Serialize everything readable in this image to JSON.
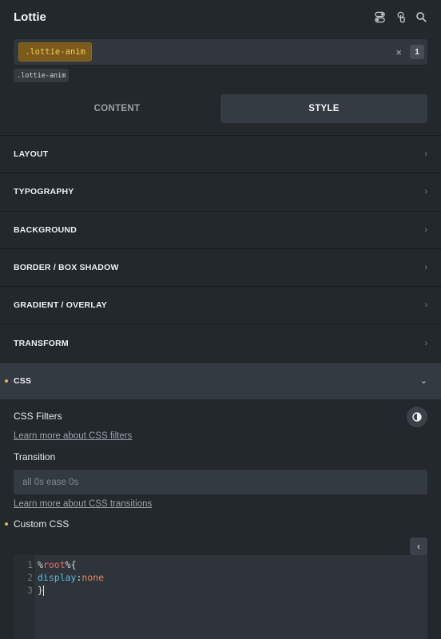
{
  "header": {
    "title": "Lottie",
    "icons": [
      "toggle-icon",
      "touch-icon",
      "search-icon"
    ]
  },
  "selector": {
    "active_class": ".lottie-anim",
    "clear_symbol": "×",
    "count": "1",
    "class_chip": ".lottie-anim"
  },
  "tabs": {
    "content": "CONTENT",
    "style": "STYLE",
    "active": "style"
  },
  "sections": [
    {
      "label": "LAYOUT",
      "open": false
    },
    {
      "label": "TYPOGRAPHY",
      "open": false
    },
    {
      "label": "BACKGROUND",
      "open": false
    },
    {
      "label": "BORDER / BOX SHADOW",
      "open": false
    },
    {
      "label": "GRADIENT / OVERLAY",
      "open": false
    },
    {
      "label": "TRANSFORM",
      "open": false
    },
    {
      "label": "CSS",
      "open": true
    }
  ],
  "css_panel": {
    "filters_label": "CSS Filters",
    "filters_link": "Learn more about CSS filters",
    "transition_label": "Transition",
    "transition_placeholder": "all 0s ease 0s",
    "transition_link": "Learn more about CSS transitions",
    "custom_css_label": "Custom CSS"
  },
  "editor": {
    "line_numbers": [
      "1",
      "2",
      "3"
    ],
    "lines": [
      {
        "a": "%",
        "b": "root",
        "c": "%{"
      },
      {
        "prop": "display",
        "sep": ":",
        "val": "none"
      },
      {
        "text": "}"
      }
    ]
  },
  "colors": {
    "accent": "#e8b53b",
    "background": "#23282d",
    "panel": "#333a41"
  }
}
